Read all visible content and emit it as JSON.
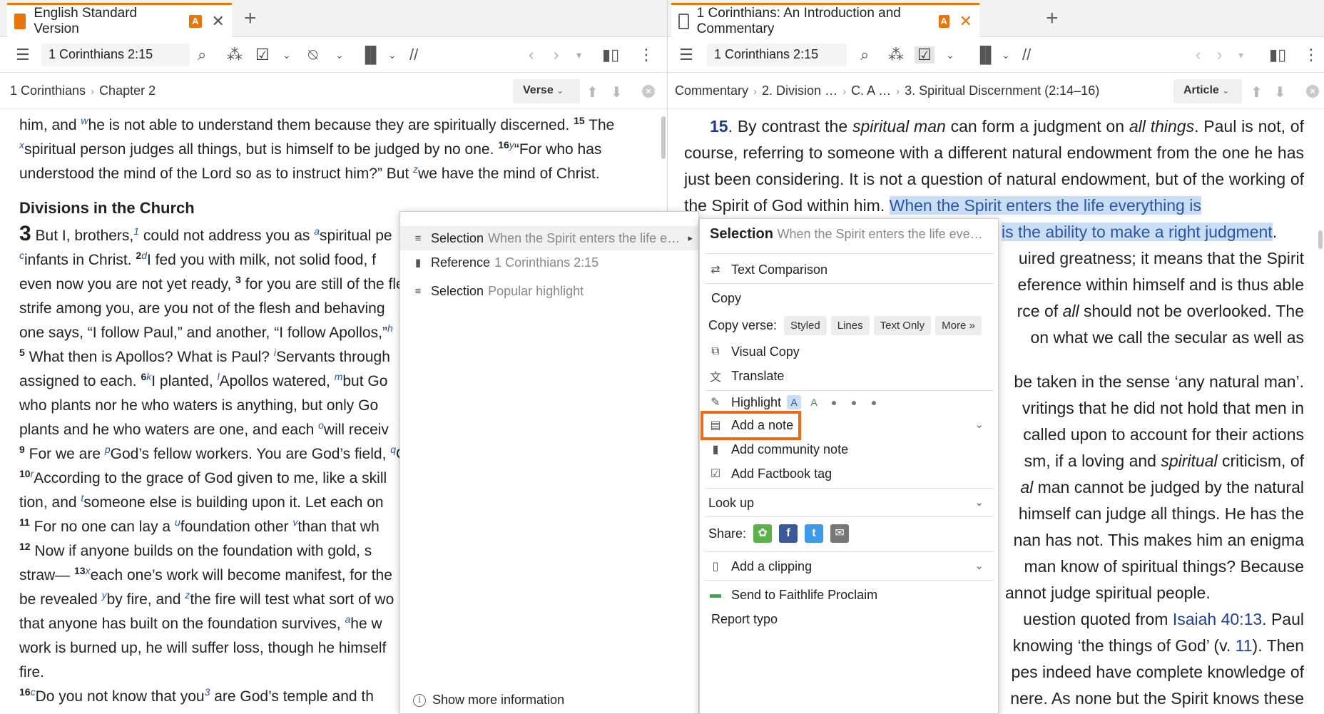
{
  "left": {
    "tab_title": "English Standard Version",
    "tab_badge": "A",
    "reference": "1 Corinthians 2:15",
    "crumb_book": "1 Corinthians",
    "crumb_chapter": "Chapter 2",
    "mode": "Verse",
    "lines": {
      "l1a": "him, and ",
      "l1b": "he is not able to understand them because they are spiritually discerned. ",
      "l1c": " The",
      "l2a": "spiritual person judges all things, but is himself to be judged by no one. ",
      "l2b": "“For who has",
      "l3": "understood the mind of the Lord so as to instruct him?” But ",
      "l3b": "we have the mind of Christ.",
      "heading": "Divisions in the Church",
      "chap": "3",
      "p1": " But I, brothers,",
      "p1b": " could not address you as ",
      "p1c": "spiritual pe",
      "p2": "infants in Christ. ",
      "p2b": "I fed you with milk, not solid food, f",
      "p3": "even now you are not yet ready, ",
      "p3b": " for you are still of the fle",
      "p4": "strife among you, are you not of the flesh and behaving",
      "p5": "one says, “I follow Paul,” and another, “I follow Apollos,”",
      "p6": " What then is Apollos? What is Paul? ",
      "p6b": "Servants through",
      "p7": "assigned to each. ",
      "p7b": "I planted, ",
      "p7c": "Apollos watered, ",
      "p7d": "but Go",
      "p8": "who plants nor he who waters is anything, but only Go",
      "p9": "plants and he who waters are one, and each ",
      "p9b": "will receiv",
      "p10": " For we are ",
      "p10b": "God’s fellow workers. You are God’s field, ",
      "p10c": "G",
      "p11": "According to the grace of God given to me, like a skill",
      "p12": "tion, and ",
      "p12b": "someone else is building upon it. Let each on",
      "p13": " For no one can lay a ",
      "p13b": "foundation other ",
      "p13c": "than that wh",
      "p14": " Now if anyone builds on the foundation with gold, s",
      "p15": "straw— ",
      "p15b": "each one’s work will become manifest, for the",
      "p16": "be revealed ",
      "p16b": "by fire, and ",
      "p16c": "the fire will test what sort of wo",
      "p17": "that anyone has built on the foundation survives, ",
      "p17b": "he w",
      "p18": "work is burned up, he will suffer loss, though he himself",
      "p19": "fire.",
      "p20": "Do you not know that you",
      "p20b": " are God’s temple and th"
    }
  },
  "right": {
    "tab_title": "1 Corinthians: An Introduction and Commentary",
    "tab_badge": "A",
    "reference": "1 Corinthians 2:15",
    "crumbs": [
      "Commentary",
      "2. Division …",
      "C. A …",
      "3. Spiritual Discernment (2:14–16)"
    ],
    "mode": "Article",
    "text": {
      "vnum": "15",
      "a": ". By contrast the ",
      "a_i1": "spiritual man",
      "a2": " can form a judgment on ",
      "a_i2": "all things",
      "a3": ". Paul is not, of course, referring to someone with a different natural endowment from the one he has just been considering. It is not a question of natural endowment, but of the working of the Spirit of God within him. ",
      "hl": "When the Spirit enters the life everything is",
      "hl2": "is the ability to make a right judgment",
      "b1": "uired greatness; it means that the Spirit",
      "b2": "eference within himself and is thus able",
      "b3a": "rce of ",
      "b3i": "all",
      "b3b": " should not be overlooked. The",
      "b4": " on what we call the secular as well as",
      "c1": "be taken in the sense ‘any natural man’.",
      "c2": "vritings that he did not hold that men in",
      "c3": "called upon to account for their actions",
      "c4a": "sm, if a loving and ",
      "c4i": "spiritual",
      "c4b": " criticism, of",
      "c5a": "al",
      "c5b": " man cannot be judged by the natural",
      "c6": "himself can judge all things. He has the",
      "c7": "nan has not. This makes him an enigma",
      "c8": " man know of spiritual things? Because",
      "c9": "annot judge spiritual people.",
      "c10a": "uestion quoted from ",
      "c10link": "Isaiah 40:13",
      "c10b": ". Paul",
      "c11a": "knowing ‘the things of God’ (v. ",
      "c11link": "11",
      "c11b": "). Then",
      "c12": "pes indeed have complete knowledge of",
      "c13": "nere. As none but the Spirit knows these"
    }
  },
  "context_menu": {
    "items": [
      {
        "label": "Selection",
        "detail": "When the Spirit enters the life e…"
      },
      {
        "label": "Reference",
        "detail": "1 Corinthians 2:15"
      },
      {
        "label": "Selection",
        "detail": "Popular highlight"
      }
    ],
    "footer": "Show more information"
  },
  "submenu": {
    "title": "Selection",
    "title_detail": "When the Spirit enters the life eve…",
    "text_comparison": "Text Comparison",
    "copy": "Copy",
    "copy_verse": "Copy verse:",
    "copy_buttons": [
      "Styled",
      "Lines",
      "Text Only",
      "More »"
    ],
    "visual_copy": "Visual Copy",
    "translate": "Translate",
    "highlight": "Highlight",
    "add_note": "Add a note",
    "add_community_note": "Add community note",
    "add_factbook_tag": "Add Factbook tag",
    "look_up": "Look up",
    "share": "Share:",
    "add_clipping": "Add a clipping",
    "send_proclaim": "Send to Faithlife Proclaim",
    "report_typo": "Report typo"
  },
  "colors": {
    "accent": "#e8740c",
    "highlight_bg": "#c9ddf4",
    "link": "#2a55a8",
    "callout": "#ee6a15"
  }
}
